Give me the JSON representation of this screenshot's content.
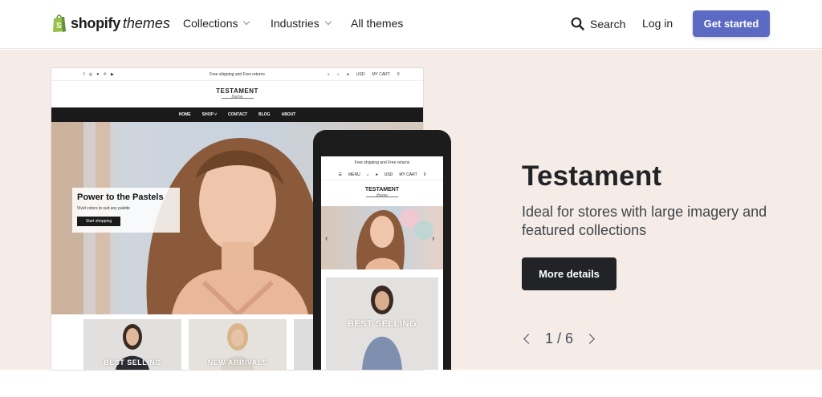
{
  "nav": {
    "logo_brand": "shopify",
    "logo_sub": "themes",
    "links": [
      "Collections",
      "Industries",
      "All themes"
    ],
    "search_label": "Search",
    "login_label": "Log in",
    "cta_label": "Get started",
    "accent_color": "#5c6ac4"
  },
  "preview": {
    "desktop": {
      "social_icons": "f ◎ ♥ ℗ ▶",
      "promo": "Free shipping and Free returns",
      "currency": "USD",
      "cart": "MY CART",
      "cart_count": "0",
      "logo": "TESTAMENT",
      "logo_sub": "theme",
      "menu": [
        "HOME",
        "SHOP",
        "CONTACT",
        "BLOG",
        "ABOUT"
      ],
      "hero_title": "Power to the Pastels",
      "hero_sub": "Vivid colors to suit any palette",
      "hero_button": "Start shopping",
      "tiles": [
        "BEST SELLING",
        "NEW ARRIVALS"
      ]
    },
    "mobile": {
      "promo": "Free shipping and Free returns",
      "menu": "MENU",
      "currency": "USD",
      "cart": "MY CART",
      "cart_count": "0",
      "logo": "TESTAMENT",
      "logo_sub": "theme",
      "tile": "BEST SELLING"
    }
  },
  "theme": {
    "title": "Testament",
    "description": "Ideal for stores with large imagery and featured collections",
    "button": "More details",
    "pager": "1 / 6"
  }
}
